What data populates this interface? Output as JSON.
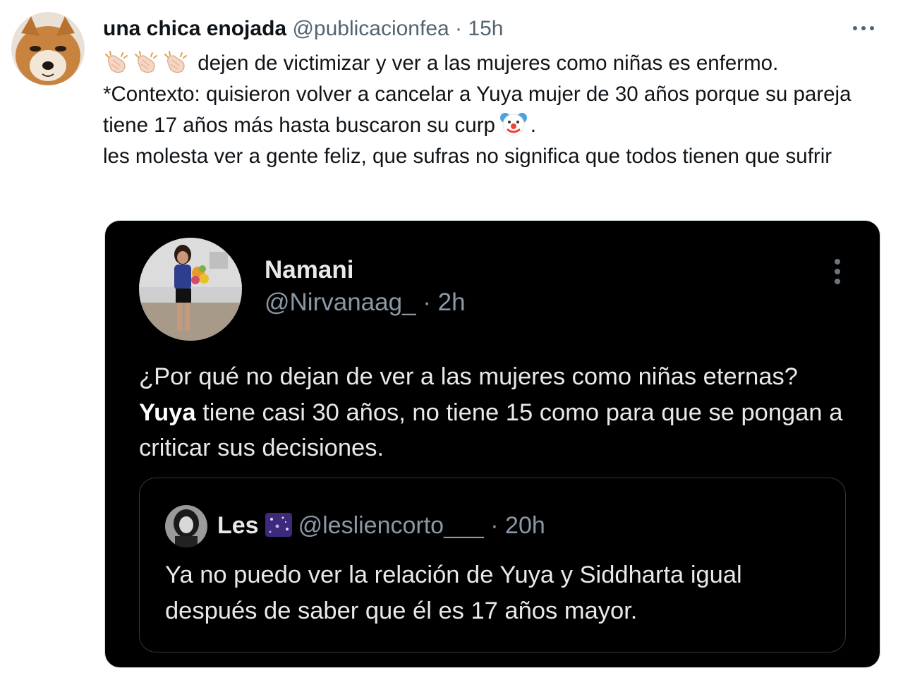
{
  "tweet": {
    "author_name": "una chica enojada",
    "author_handle": "@publicacionfea",
    "separator": "·",
    "time": "15h",
    "more_label": "···",
    "emojis": [
      "clapping-hands-icon",
      "clapping-hands-icon",
      "clapping-hands-icon",
      "clown-face-icon"
    ],
    "line1": "dejen de victimizar y ver a las mujeres como niñas es enfermo.",
    "line2_pre": "*Contexto: quisieron volver a cancelar a Yuya mujer de 30 años porque su pareja tiene 17 años más hasta buscaron su curp",
    "line2_post": ".",
    "line3": "les molesta ver a gente feliz, que sufras no significa que todos tienen que sufrir"
  },
  "embedded_post": {
    "name": "Namani",
    "handle": "@Nirvanaag_",
    "separator": "·",
    "time": "2h",
    "text_before": "¿Por qué no dejan de ver a las mujeres como niñas eternas? ",
    "text_bold": "Yuya",
    "text_after": " tiene casi 30 años, no tiene 15 como para que se pongan a criticar sus decisiones.",
    "quote": {
      "name": "Les",
      "handle": "@lesliencorto___",
      "separator": "·",
      "time": "20h",
      "text": "Ya no puedo ver la relación de Yuya y Siddharta igual después de saber que él es 17 años mayor."
    }
  },
  "colors": {
    "text_primary": "#0f1419",
    "text_secondary": "#536471",
    "dark_bg": "#000000",
    "dark_text": "#e7e9ea",
    "dark_secondary": "#8b98a5"
  }
}
